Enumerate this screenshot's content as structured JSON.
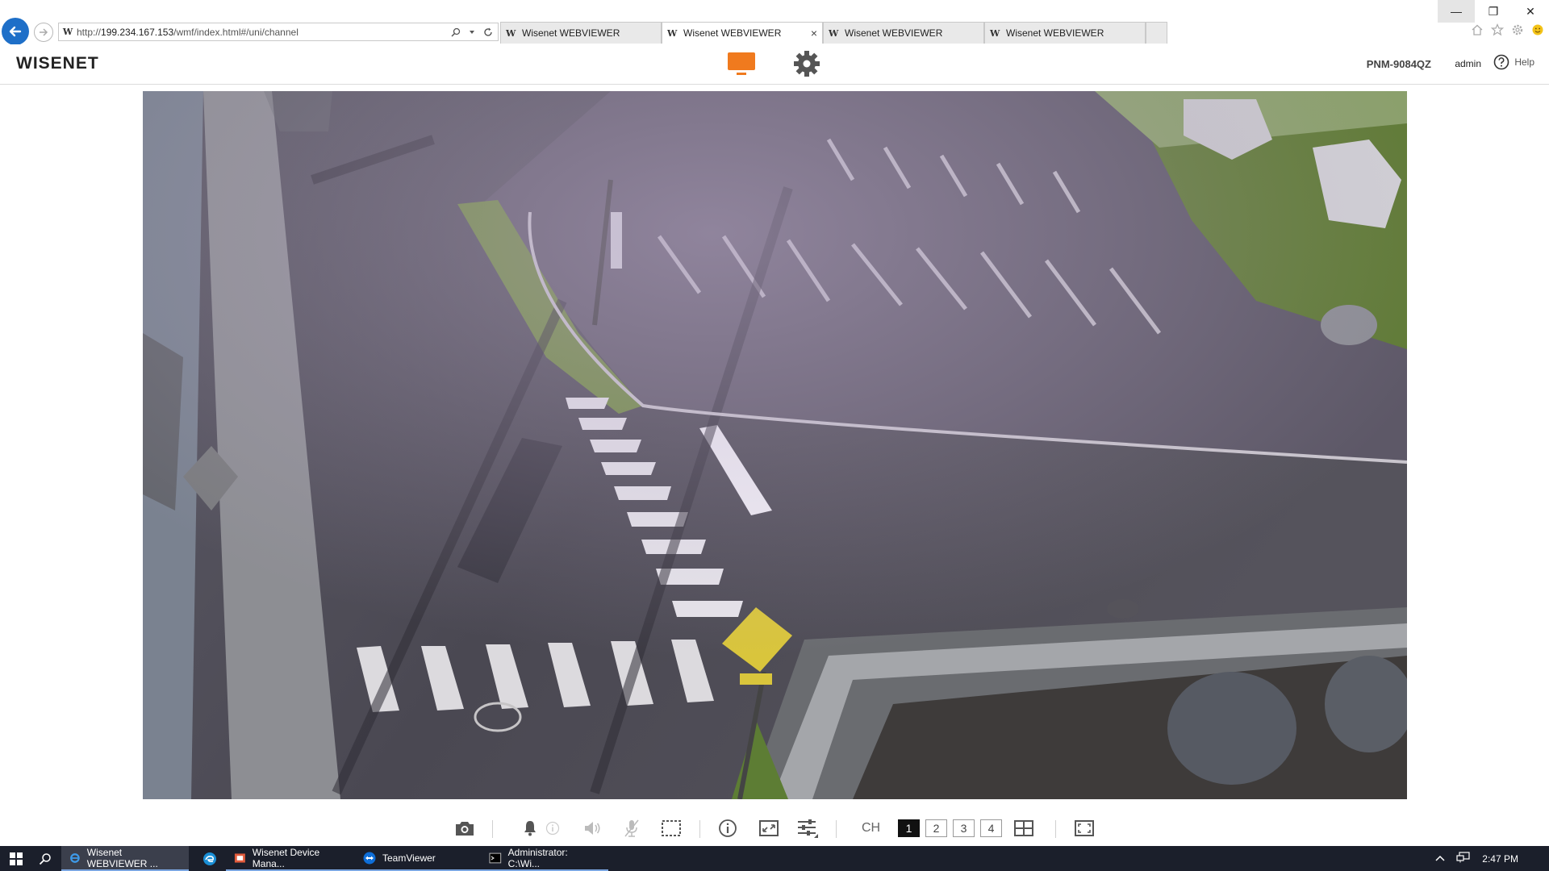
{
  "browser": {
    "url_prefix": "http://",
    "url_host": "199.234.167.153",
    "url_path": "/wmf/index.html#/uni/channel",
    "tabs": [
      {
        "label": "Wisenet WEBVIEWER",
        "active": false
      },
      {
        "label": "Wisenet WEBVIEWER",
        "active": true
      },
      {
        "label": "Wisenet WEBVIEWER",
        "active": false
      },
      {
        "label": "Wisenet WEBVIEWER",
        "active": false
      }
    ],
    "favicon_letter": "W",
    "close_glyph": "×",
    "window_controls": {
      "minimize": "—",
      "restore": "❐",
      "close": "✕"
    }
  },
  "header": {
    "logo": "WISENET",
    "model": "PNM-9084QZ",
    "user": "admin",
    "help_label": "Help",
    "monitor_color": "#f07a1e",
    "settings_color": "#555555"
  },
  "video": {
    "icons": [
      "camera-feed"
    ]
  },
  "controls": {
    "ch_label": "CH",
    "channels": [
      "1",
      "2",
      "3",
      "4"
    ],
    "active_channel": "1"
  },
  "taskbar": {
    "apps": [
      {
        "label": "Wisenet WEBVIEWER ...",
        "state": "active"
      },
      {
        "label": "",
        "state": "pinned"
      },
      {
        "label": "Wisenet Device Mana...",
        "state": "open"
      },
      {
        "label": "TeamViewer",
        "state": "open"
      },
      {
        "label": "Administrator: C:\\Wi...",
        "state": "open"
      }
    ],
    "clock": "2:47 PM"
  },
  "colors": {
    "accent": "#1e6fc8",
    "taskbar_bg": "#1b1f2b"
  }
}
